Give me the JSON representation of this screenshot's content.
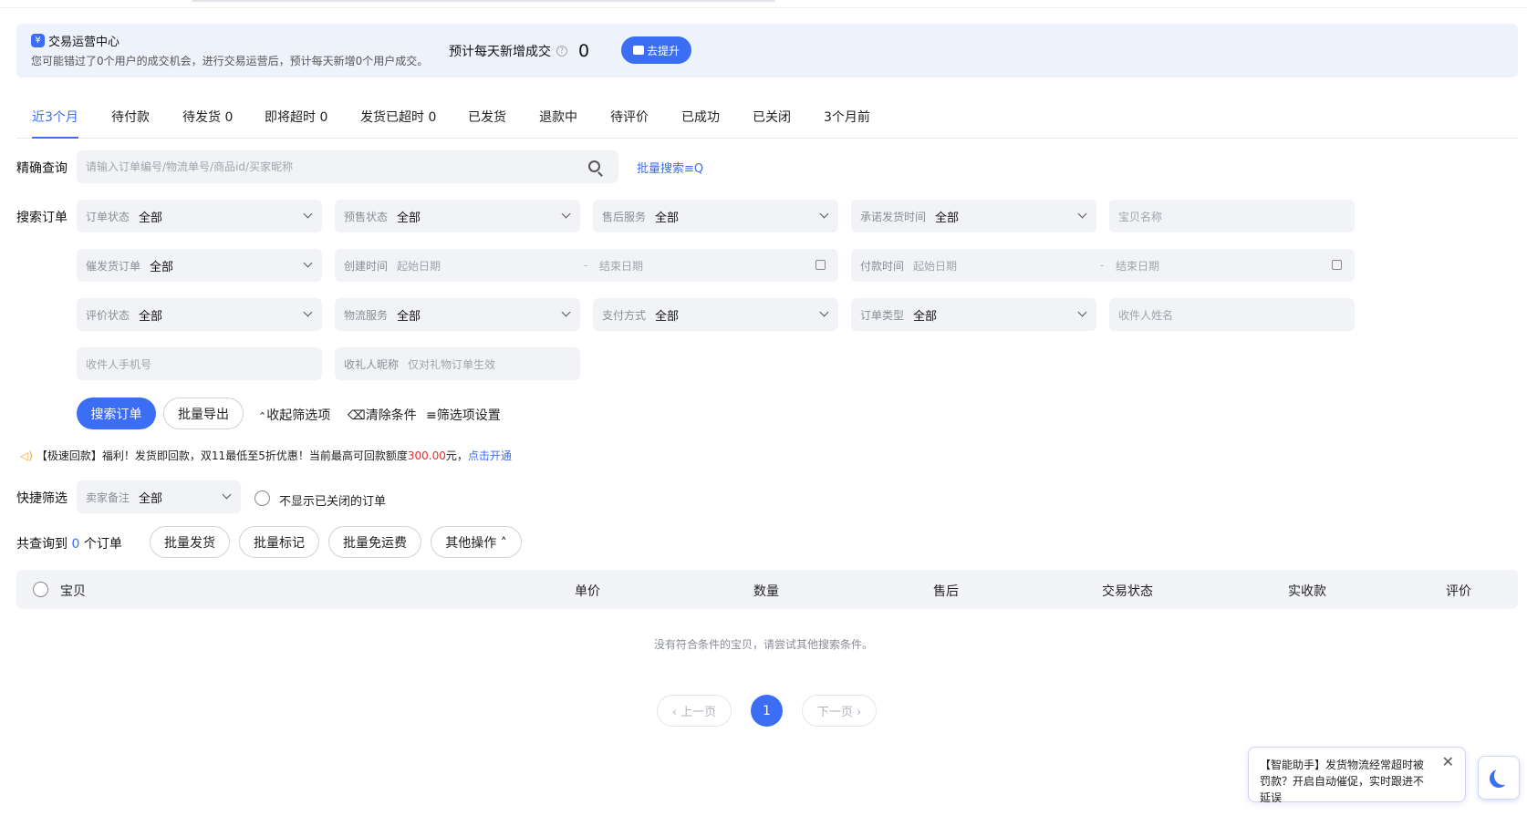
{
  "banner": {
    "title": "交易运营中心",
    "desc": "您可能错过了0个用户的成交机会，进行交易运营后，预计每天新增0个用户成交。",
    "predict_label": "预计每天新增成交",
    "predict_value": "0",
    "button": "去提升"
  },
  "tabs": [
    "近3个月",
    "待付款",
    "待发货 0",
    "即将超时 0",
    "发货已超时 0",
    "已发货",
    "退款中",
    "待评价",
    "已成功",
    "已关闭",
    "3个月前"
  ],
  "exact_search": {
    "label": "精确查询",
    "placeholder": "请输入订单编号/物流单号/商品id/买家昵称",
    "batch_link": "批量搜索≡Q"
  },
  "filters": {
    "label": "搜索订单",
    "order_status": {
      "label": "订单状态",
      "value": "全部"
    },
    "presale_status": {
      "label": "预售状态",
      "value": "全部"
    },
    "after_sale": {
      "label": "售后服务",
      "value": "全部"
    },
    "promise_ship": {
      "label": "承诺发货时间",
      "value": "全部"
    },
    "item_name": {
      "placeholder": "宝贝名称"
    },
    "urge_ship": {
      "label": "催发货订单",
      "value": "全部"
    },
    "create_time": {
      "label": "创建时间",
      "start": "起始日期",
      "end": "结束日期"
    },
    "pay_time": {
      "label": "付款时间",
      "start": "起始日期",
      "end": "结束日期"
    },
    "review_status": {
      "label": "评价状态",
      "value": "全部"
    },
    "logistics": {
      "label": "物流服务",
      "value": "全部"
    },
    "pay_method": {
      "label": "支付方式",
      "value": "全部"
    },
    "order_type": {
      "label": "订单类型",
      "value": "全部"
    },
    "receiver_name": {
      "placeholder": "收件人姓名"
    },
    "receiver_phone": {
      "placeholder": "收件人手机号"
    },
    "gift_nick": {
      "label": "收礼人昵称",
      "placeholder": "仅对礼物订单生效"
    }
  },
  "actions": {
    "search": "搜索订单",
    "export": "批量导出",
    "collapse": "收起筛选项",
    "clear": "清除条件",
    "settings": "筛选项设置"
  },
  "notice": {
    "text": "【极速回款】福利！发货即回款，双11最低至5折优惠！当前最高可回款额度",
    "amount": "300.00",
    "unit": "元，",
    "link": "点击开通"
  },
  "quick": {
    "label": "快捷筛选",
    "remark_label": "卖家备注",
    "remark_value": "全部",
    "hide_closed": "不显示已关闭的订单"
  },
  "result": {
    "prefix": "共查询到",
    "count": "0",
    "suffix": "个订单",
    "batch_ship": "批量发货",
    "batch_mark": "批量标记",
    "batch_free": "批量免运费",
    "other": "其他操作 ˄"
  },
  "table": {
    "headers": [
      "宝贝",
      "单价",
      "数量",
      "售后",
      "交易状态",
      "实收款",
      "评价"
    ],
    "empty": "没有符合条件的宝贝，请尝试其他搜索条件。"
  },
  "pager": {
    "prev": "‹ 上一页",
    "current": "1",
    "next": "下一页 ›"
  },
  "assistant": {
    "text": "【智能助手】发货物流经常超时被罚款？开启自动催促，实时跟进不延误",
    "close": "✕"
  }
}
